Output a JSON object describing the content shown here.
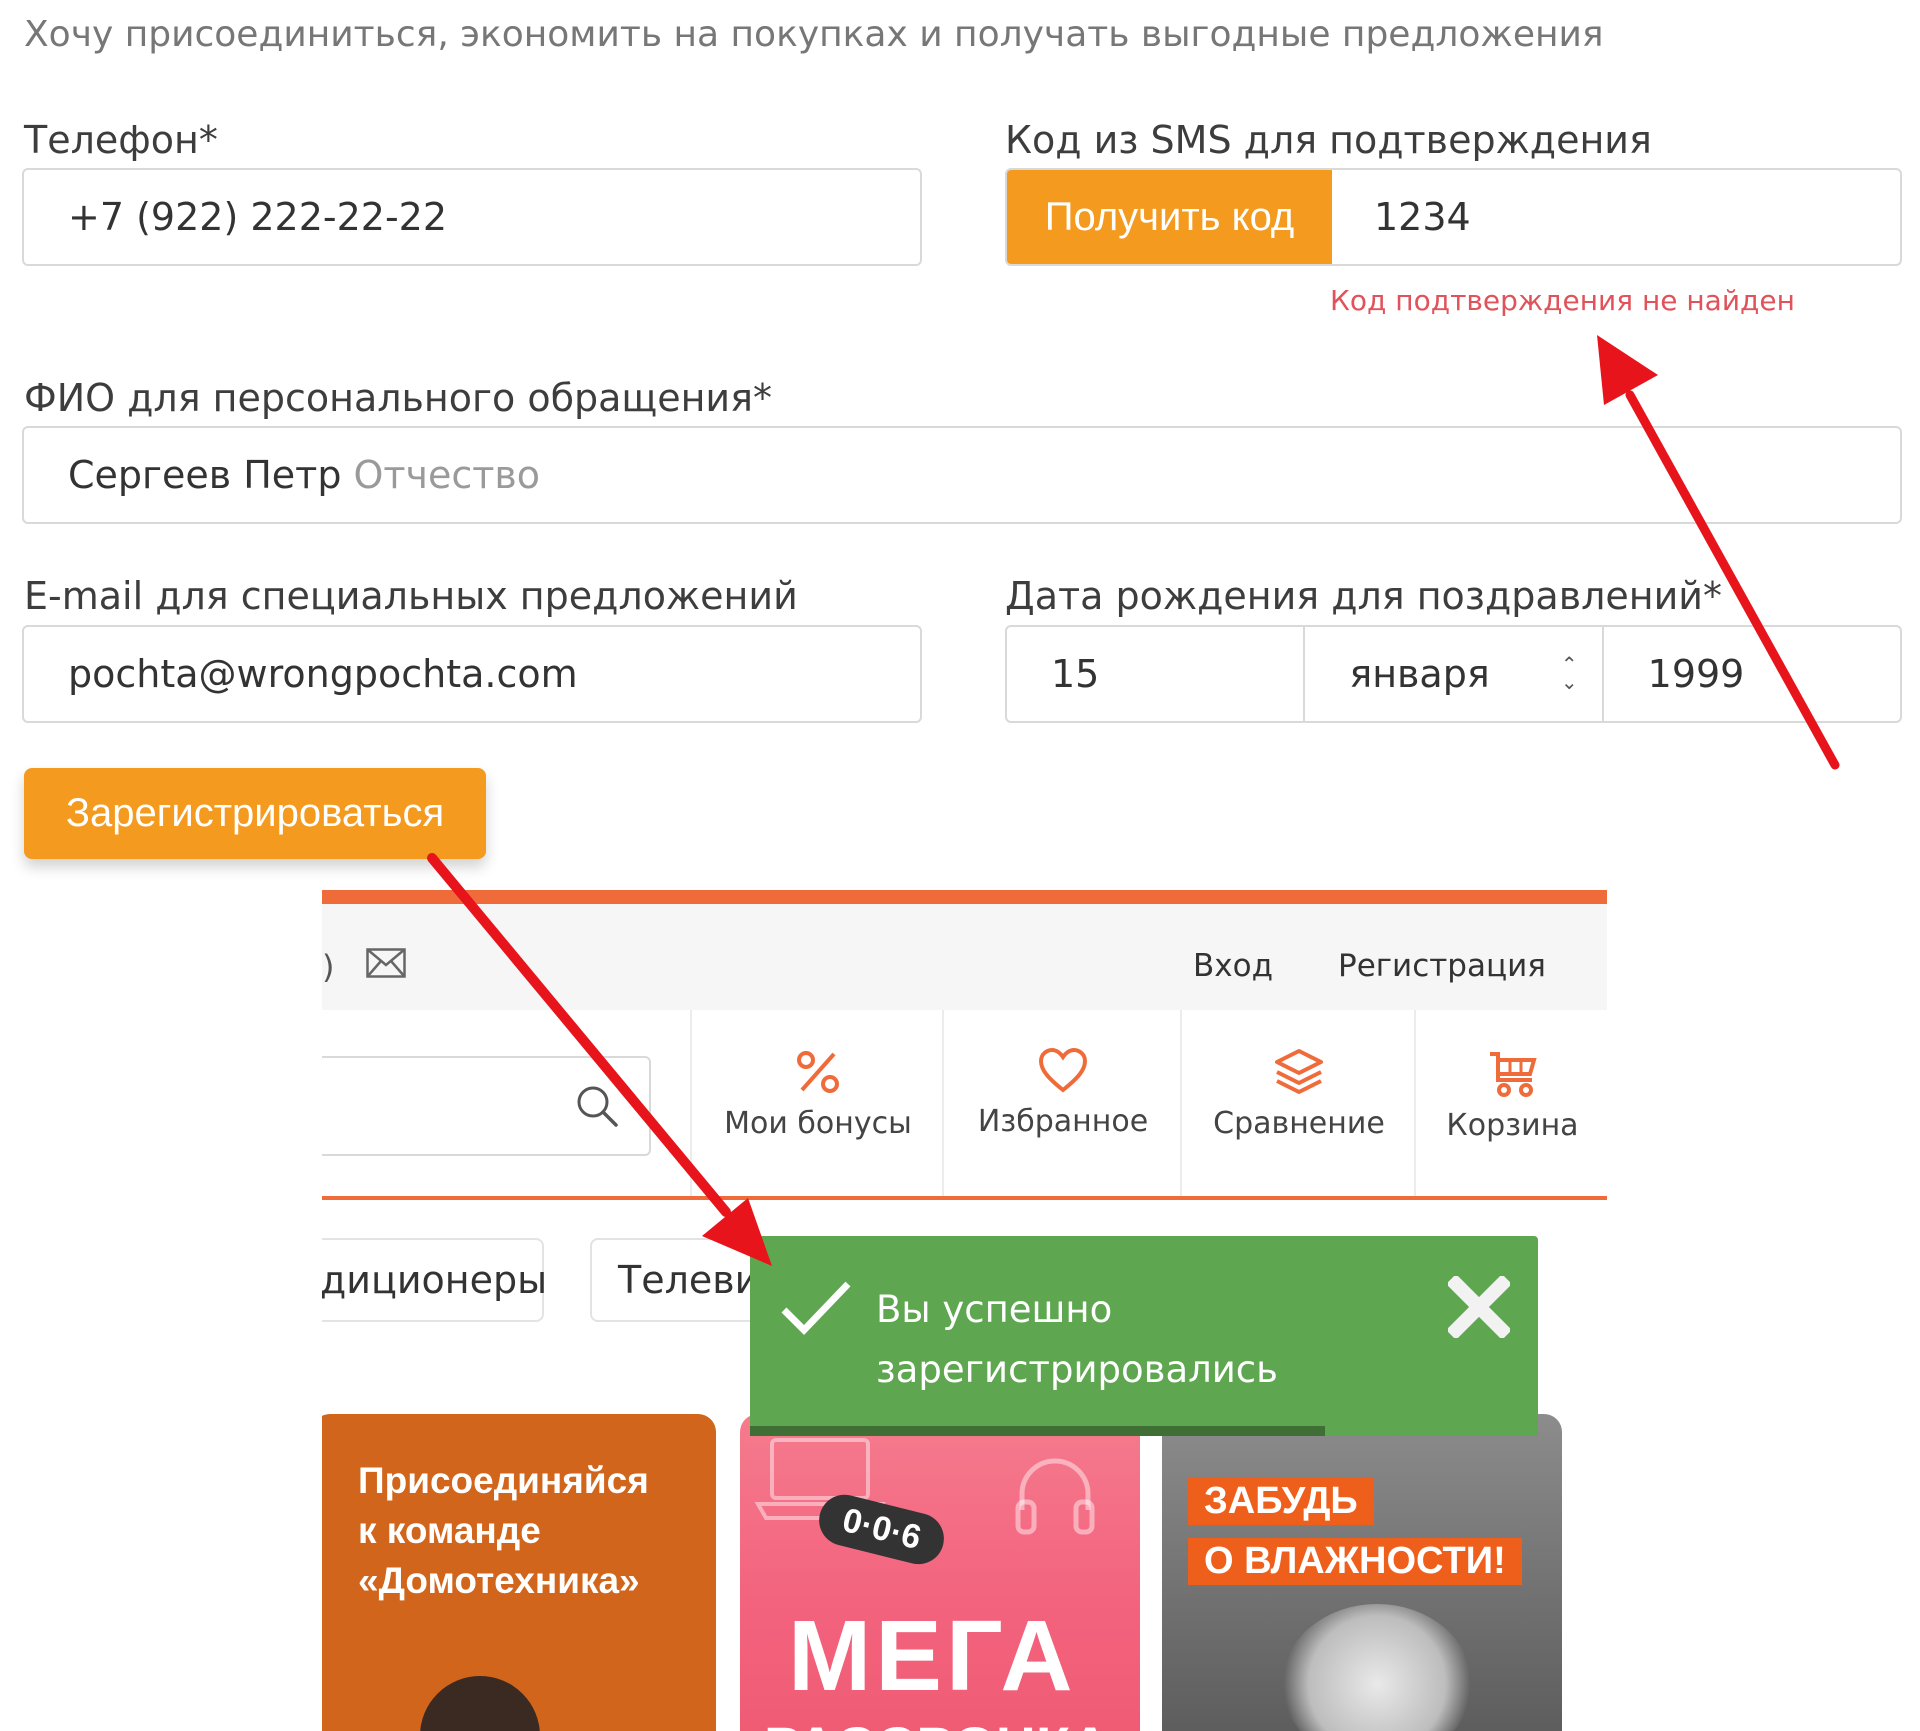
{
  "form": {
    "intro": "Хочу присоединиться, экономить на покупках и получать выгодные предложения",
    "phone_label": "Телефон*",
    "phone_value": "+7 (922) 222-22-22",
    "sms_label": "Код из SMS для подтверждения",
    "get_code_button": "Получить код",
    "code_value": "1234",
    "code_error": "Код подтверждения не найден",
    "fio_label": "ФИО для персонального обращения*",
    "fio_value": "Сергеев Петр",
    "fio_placeholder": "Отчество",
    "email_label": "E-mail для специальных предложений",
    "email_value": "pochta@wrongpochta.com",
    "birth_label": "Дата рождения для поздравлений*",
    "birth_day": "15",
    "birth_month": "января",
    "birth_year": "1999",
    "register_button": "Зарегистрироваться"
  },
  "site": {
    "topbar": {
      "partial": ")",
      "login": "Вход",
      "register": "Регистрация"
    },
    "nav": {
      "bonuses": "Мои бонусы",
      "favorites": "Избранное",
      "compare": "Сравнение",
      "cart": "Корзина"
    },
    "chips": [
      "диционеры",
      "Телевиз"
    ],
    "banners": {
      "b1": [
        "Присоединяйся",
        "к команде",
        "«Домотехника»"
      ],
      "b2_badge": "0·0·6",
      "b2_title": "МЕГА",
      "b2_sub": "РАССРОЧКА",
      "b3_line1": "ЗАБУДЬ",
      "b3_line2": "О ВЛАЖНОСТИ!"
    },
    "icons": [
      "mail-icon",
      "search-icon",
      "percent-icon",
      "heart-icon",
      "layers-icon",
      "cart-icon"
    ]
  },
  "toast": {
    "line1": "Вы успешно",
    "line2": "зарегистрировались",
    "progress": 0.73,
    "icons": [
      "check-icon",
      "close-icon"
    ]
  },
  "colors": {
    "orange": "#f39a1f",
    "error": "#e0535b",
    "toast": "#5ea650",
    "accent": "#ef6b3a",
    "arrow": "#e8141c"
  }
}
